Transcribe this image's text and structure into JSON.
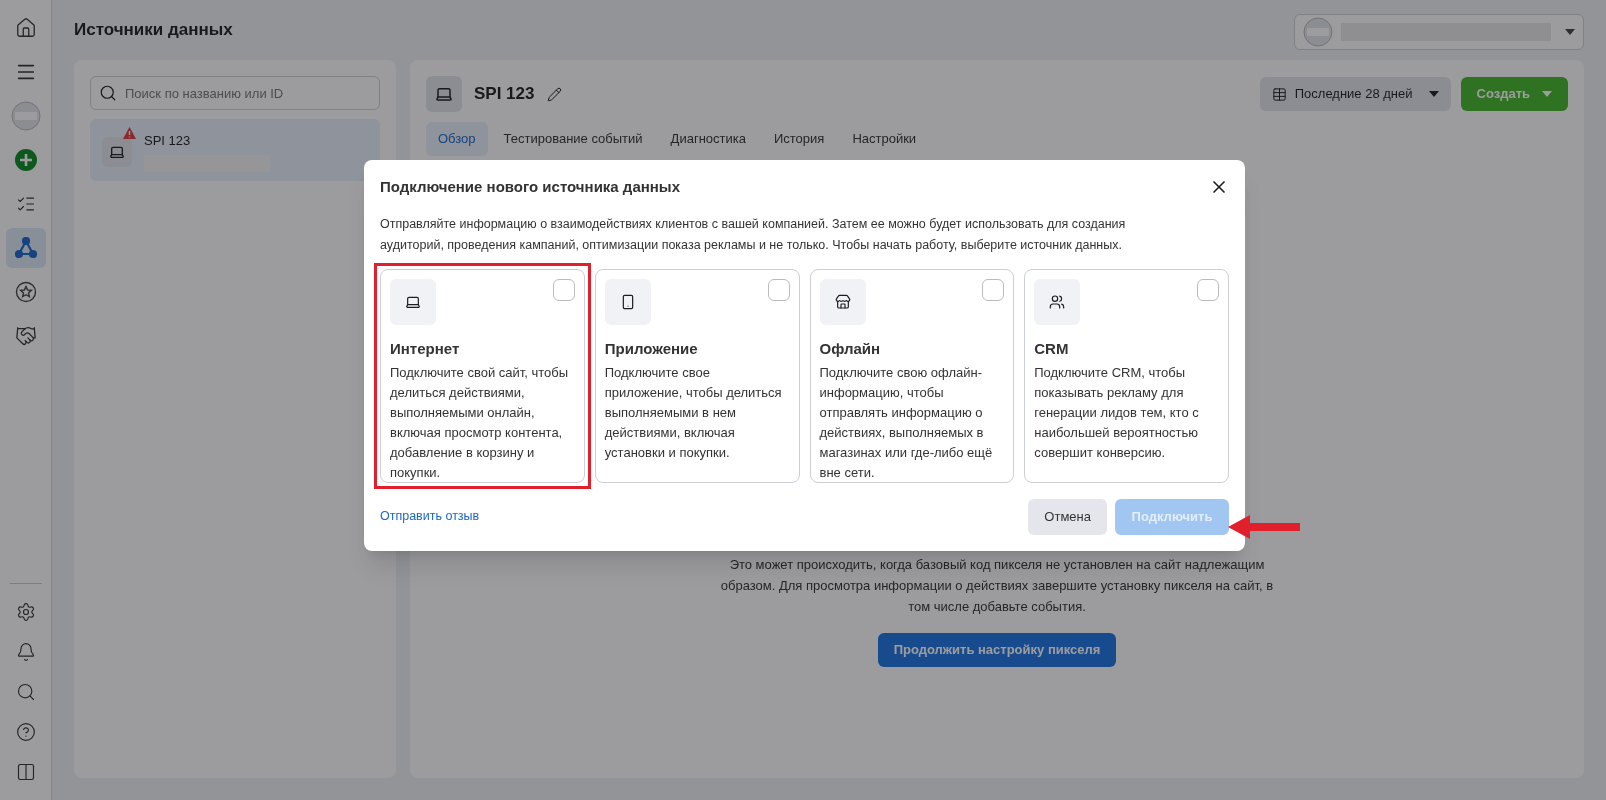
{
  "rail": {
    "top": [
      {
        "selected": false
      },
      {
        "selected": false
      },
      {
        "selected": false
      },
      {
        "selected": false
      },
      {
        "selected": false
      },
      {
        "selected": true
      },
      {
        "selected": false
      },
      {
        "selected": false
      }
    ],
    "bottom": [
      {
        "selected": false
      },
      {
        "selected": false
      },
      {
        "selected": false
      },
      {
        "selected": false
      },
      {
        "selected": false
      }
    ]
  },
  "page_title": "Источники данных",
  "sources_panel": {
    "search": {
      "placeholder": "Поиск по названию или ID"
    },
    "items": [
      {
        "name": "SPI 123",
        "selected": true,
        "warning": true
      }
    ]
  },
  "source": {
    "name": "SPI 123",
    "tabs": [
      {
        "label": "Обзор",
        "selected": true
      },
      {
        "label": "Тестирование событий",
        "selected": false
      },
      {
        "label": "Диагностика",
        "selected": false
      },
      {
        "label": "История",
        "selected": false
      },
      {
        "label": "Настройки",
        "selected": false
      }
    ],
    "date_range": "Последние 28 дней",
    "create_button": "Создать",
    "notice": "Это может происходить, когда базовый код пикселя не установлен на сайт надлежащим образом. Для просмотра информации о действиях завершите установку пикселя на сайт, в том числе добавьте события.",
    "continue_button": "Продолжить настройку пикселя"
  },
  "dialog": {
    "title": "Подключение нового источника данных",
    "description": "Отправляйте информацию о взаимодействиях клиентов с вашей компанией. Затем ее можно будет использовать для создания аудиторий, проведения кампаний, оптимизации показа рекламы и не только. Чтобы начать работу, выберите источник данных.",
    "options": [
      {
        "title": "Интернет",
        "text": "Подключите свой сайт, чтобы делиться действиями, выполняемыми онлайн, включая просмотр контента, добавление в корзину и покупки.",
        "checked": false,
        "highlighted": true
      },
      {
        "title": "Приложение",
        "text": "Подключите свое приложение, чтобы делиться выполняемыми в нем действиями, включая установки и покупки.",
        "checked": false,
        "highlighted": false
      },
      {
        "title": "Офлайн",
        "text": "Подключите свою офлайн-информацию, чтобы отправлять информацию о действиях, выполняемых в магазинах или где-либо ещё вне сети.",
        "checked": false,
        "highlighted": false
      },
      {
        "title": "CRM",
        "text": "Подключите CRM, чтобы показывать рекламу для генерации лидов тем, кто с наибольшей вероятностью совершит конверсию.",
        "checked": false,
        "highlighted": false
      }
    ],
    "feedback_link": "Отправить отзыв",
    "cancel_button": "Отмена",
    "connect_button": {
      "label": "Подключить",
      "disabled": true
    }
  },
  "annotations": [
    {
      "kind": "arrow"
    }
  ]
}
